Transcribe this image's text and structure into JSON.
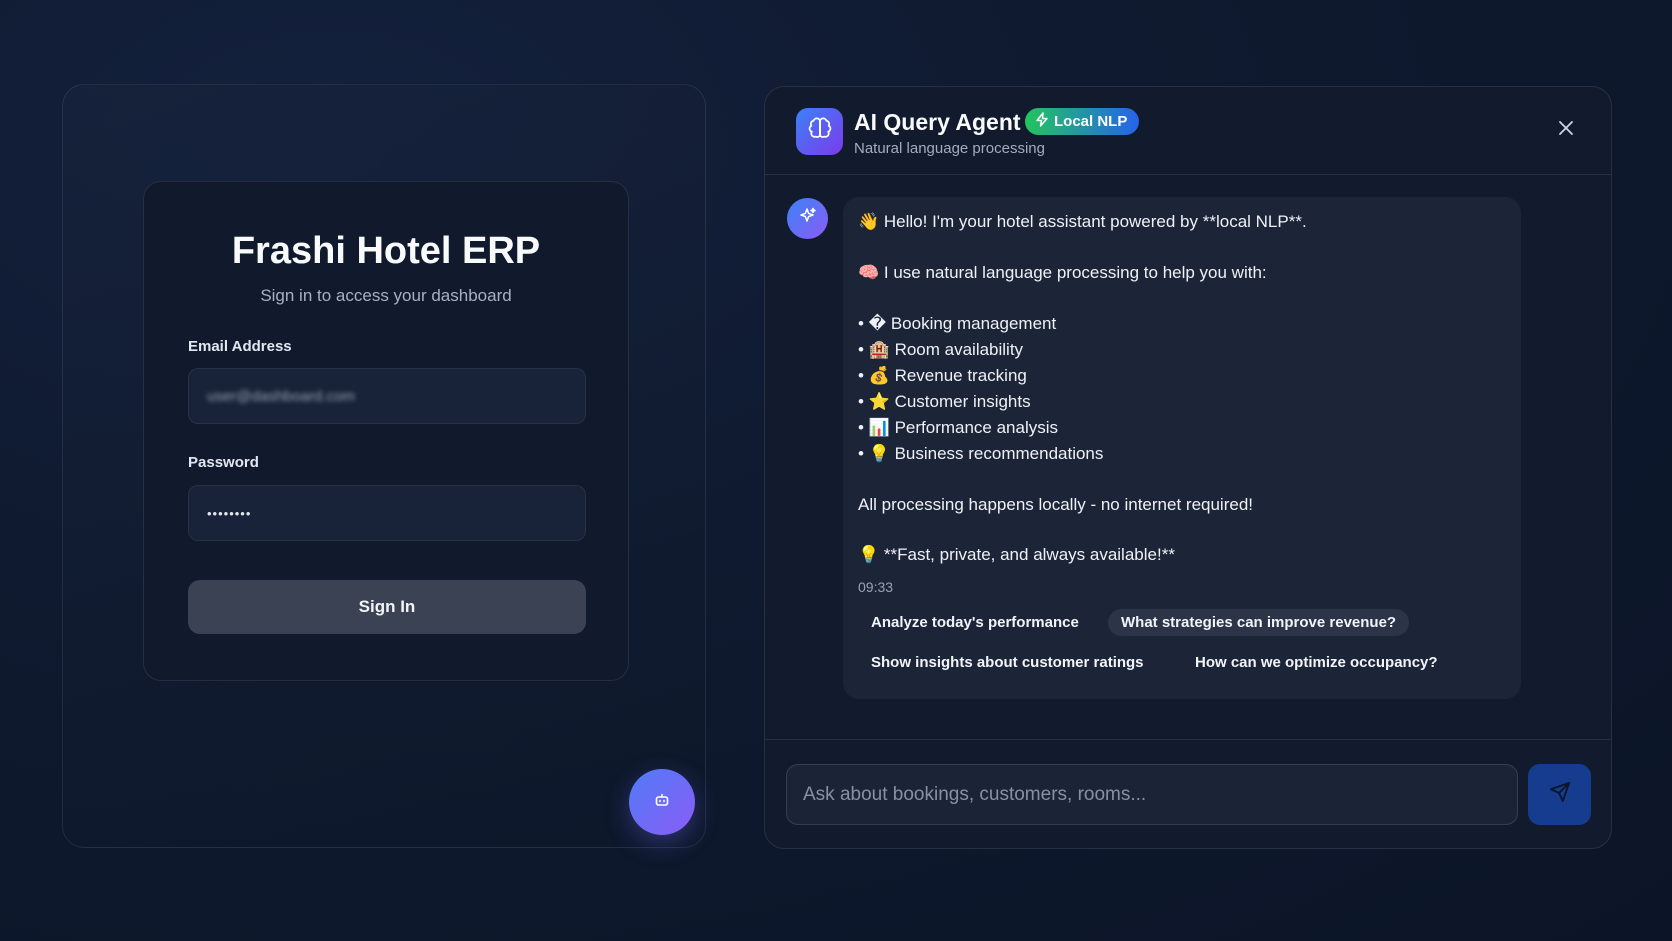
{
  "login": {
    "title": "Frashi Hotel ERP",
    "subtitle": "Sign in to access your dashboard",
    "email_label": "Email Address",
    "email_value": "user@dashboard.com",
    "password_label": "Password",
    "password_value": "••••••••",
    "signin_label": "Sign In",
    "fab_icon": "robot-icon"
  },
  "chat": {
    "title": "AI Query Agent",
    "badge": "Local NLP",
    "subtitle": "Natural language processing",
    "avatar_icon": "brain-icon",
    "close_icon": "close-icon",
    "message": {
      "lines": [
        "👋 Hello! I'm your hotel assistant powered by **local NLP**.",
        "🧠 I use natural language processing to help you with:",
        "• � Booking management",
        "• 🏨 Room availability",
        "• 💰 Revenue tracking",
        "• ⭐ Customer insights",
        "• 📊 Performance analysis",
        "• 💡 Business recommendations",
        "All processing happens locally - no internet required!",
        "💡 **Fast, private, and always available!**"
      ],
      "time": "09:33"
    },
    "suggestions": [
      "Analyze today's performance",
      "What strategies can improve revenue?",
      "Show insights about customer ratings",
      "How can we optimize occupancy?"
    ],
    "input_placeholder": "Ask about bookings, customers, rooms...",
    "send_icon": "send-icon"
  },
  "colors": {
    "background": "#0f1a30",
    "badge_start": "#22c55e",
    "badge_end": "#2563eb",
    "accent_purple": "#8b5cf6",
    "send_button": "#163c8f"
  }
}
